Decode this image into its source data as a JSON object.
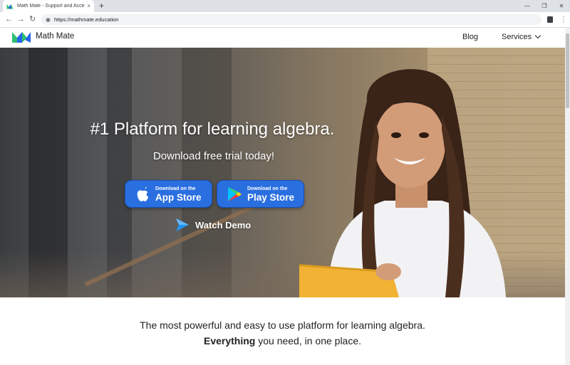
{
  "browser": {
    "tab_title": "Math Mate - Support and Accessi",
    "tab_close": "×",
    "new_tab": "+",
    "url": "https://mathmate.education",
    "window_controls": [
      "—",
      "❐",
      "✕"
    ],
    "nav": {
      "back": "←",
      "forward": "→",
      "reload": "↻"
    },
    "menu": "⋮"
  },
  "header": {
    "brand": "Math Mate",
    "nav": {
      "blog": "Blog",
      "services": "Services"
    }
  },
  "hero": {
    "headline": "#1 Platform for learning algebra.",
    "subhead": "Download free trial today!",
    "app_store": {
      "small": "Download on the",
      "big": "App Store"
    },
    "play_store": {
      "small": "Download on the",
      "big": "Play Store"
    },
    "watch_demo": "Watch Demo"
  },
  "tagline": {
    "line1": "The most powerful and easy to use platform for learning algebra.",
    "line2_bold": "Everything",
    "line2_rest": " you need, in one place."
  },
  "colors": {
    "accent": "#2a6fe0",
    "logo_green": "#2fbf71",
    "logo_blue": "#2563eb"
  }
}
